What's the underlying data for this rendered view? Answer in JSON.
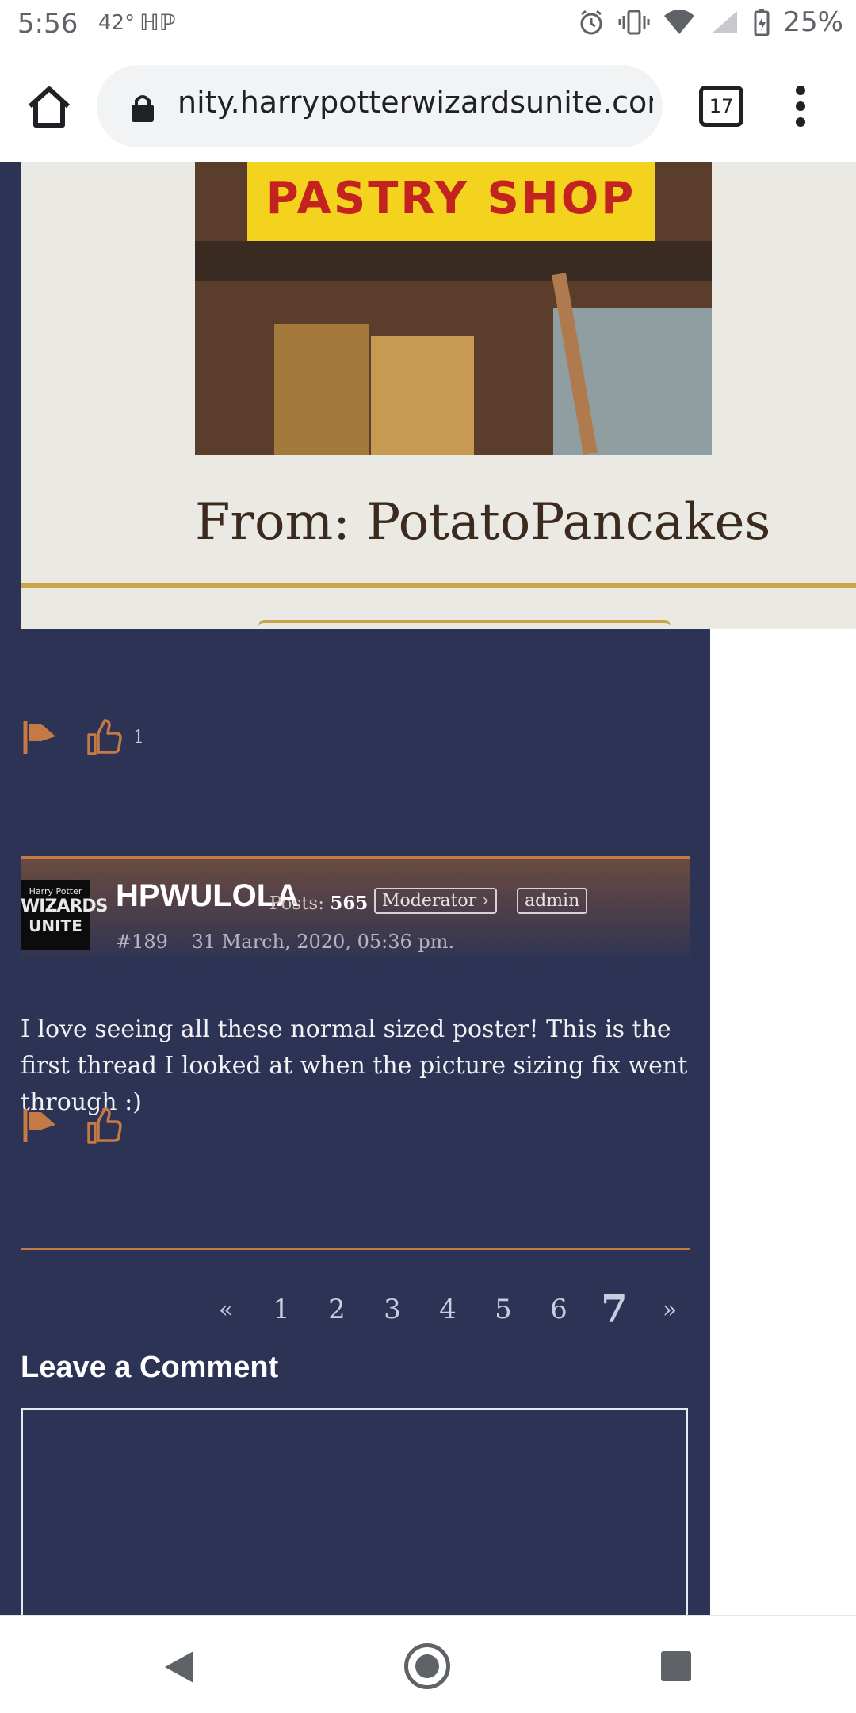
{
  "status_bar": {
    "time": "5:56",
    "temperature": "42°",
    "hp_glyph": "ℍℙ",
    "battery": "25%",
    "icons": [
      "alarm-icon",
      "vibrate-icon",
      "wifi-icon",
      "signal-icon",
      "battery-icon"
    ]
  },
  "browser": {
    "url": "nity.harrypotterwizardsunite.com",
    "tab_count": "17"
  },
  "image_post": {
    "sign_text": "PASTRY SHOP",
    "from_caption": "From: PotatoPancakes",
    "likes": "1"
  },
  "post": {
    "author": "HPWULOLA",
    "posts_label": "Posts:",
    "posts_count": "565",
    "role_badge": "Moderator ›",
    "admin_badge": "admin",
    "post_number": "#189",
    "timestamp": "31 March, 2020, 05:36 pm.",
    "body": "I love seeing all these normal sized poster! This is the first thread I looked at when the picture sizing fix went through :)",
    "avatar": {
      "line1": "Harry Potter",
      "line2": "WIZARDS",
      "line3": "UNITE"
    }
  },
  "pagination": {
    "prev": "«",
    "pages": [
      "1",
      "2",
      "3",
      "4",
      "5",
      "6",
      "7"
    ],
    "current": "7",
    "next": "»"
  },
  "comment": {
    "title": "Leave a Comment"
  },
  "colors": {
    "navy": "#2d3354",
    "accent": "#c57a45",
    "gold": "#c9a44b"
  }
}
